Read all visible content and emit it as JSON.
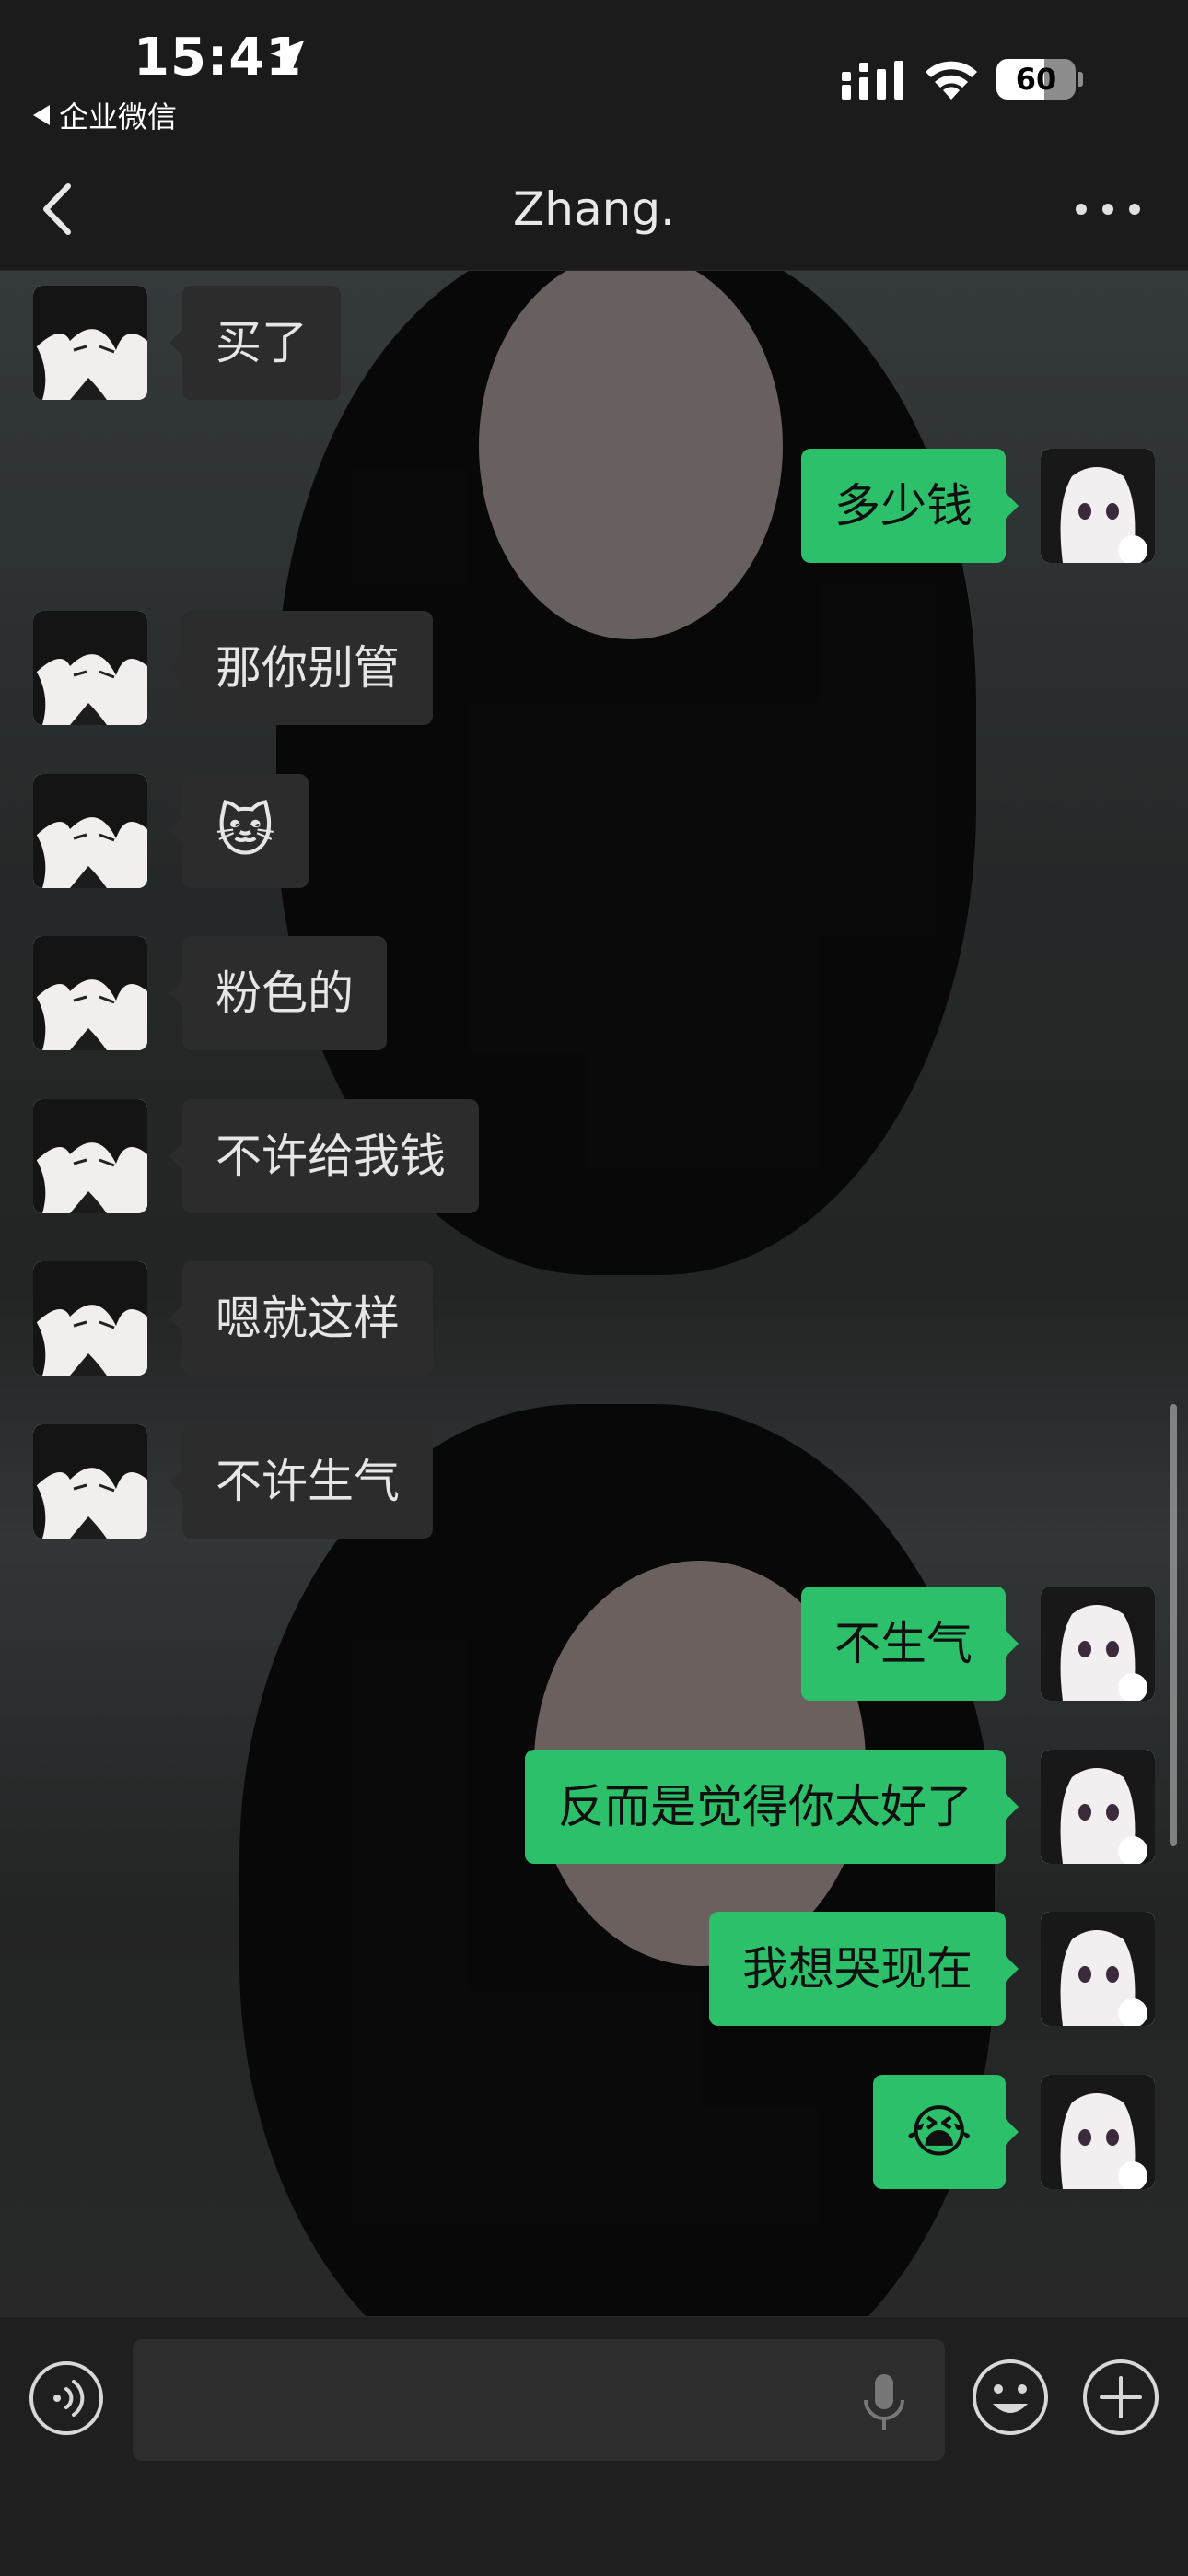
{
  "status_bar": {
    "time": "15:41",
    "back_app": "企业微信",
    "battery_level": 60,
    "battery_label": "60"
  },
  "nav": {
    "title": "Zhang.",
    "back_icon": "chevron-left-icon",
    "more_icon": "ellipsis-icon"
  },
  "messages": [
    {
      "side": "left",
      "text": "买了"
    },
    {
      "side": "right",
      "text": "多少钱"
    },
    {
      "side": "left",
      "text": "那你别管"
    },
    {
      "side": "left",
      "text": "🐱",
      "kind": "emoji",
      "emoji_name": "smirking-cat-emoji"
    },
    {
      "side": "left",
      "text": "粉色的"
    },
    {
      "side": "left",
      "text": "不许给我钱"
    },
    {
      "side": "left",
      "text": "嗯就这样"
    },
    {
      "side": "left",
      "text": "不许生气"
    },
    {
      "side": "right",
      "text": "不生气"
    },
    {
      "side": "right",
      "text": "反而是觉得你太好了"
    },
    {
      "side": "right",
      "text": "我想哭现在"
    },
    {
      "side": "right",
      "text": "😭",
      "kind": "emoji",
      "emoji_name": "crying-face-emoji"
    }
  ],
  "input_bar": {
    "placeholder": "",
    "voice_icon": "voice-mode-icon",
    "mic_icon": "microphone-icon",
    "emoji_icon": "smiley-face-icon",
    "plus_icon": "plus-circle-icon"
  },
  "colors": {
    "sent_bubble": "#2dc06a",
    "received_bubble": "#2c2c2c",
    "bar_background": "#1b1b1b"
  }
}
